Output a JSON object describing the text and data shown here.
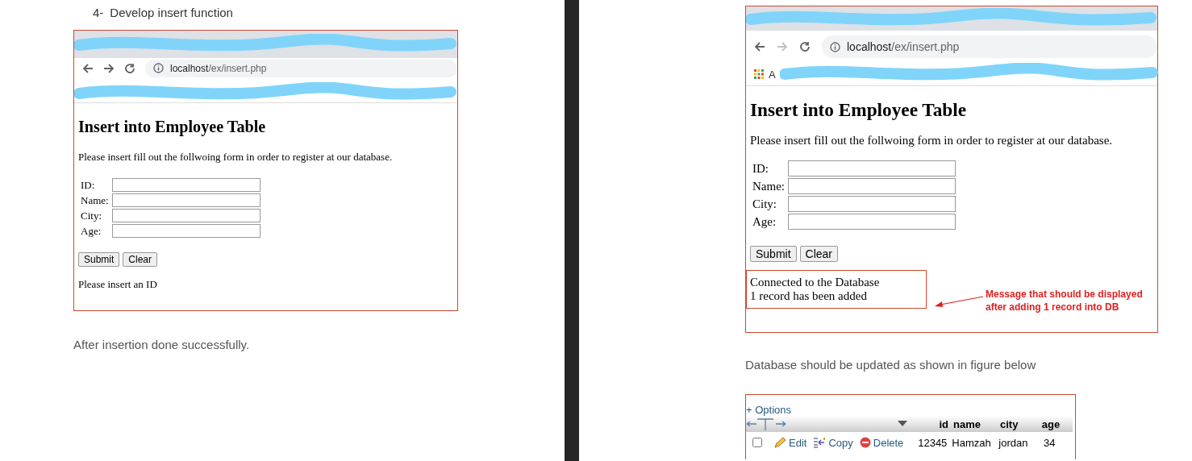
{
  "left_page": {
    "step_number": "4-",
    "step_title": "Develop insert function",
    "screenshot": {
      "address_host": "localhost",
      "address_path": "/ex/insert.php",
      "forward_enabled": true,
      "page_title": "Insert into Employee Table",
      "intro": "Please insert fill out the follwoing form in order to register at our database.",
      "fields": [
        {
          "label": "ID:"
        },
        {
          "label": "Name:"
        },
        {
          "label": "City:"
        },
        {
          "label": "Age:"
        }
      ],
      "buttons": [
        "Submit",
        "Clear"
      ],
      "messages": [
        "Please insert an ID"
      ]
    },
    "caption": "After insertion done successfully."
  },
  "right_page": {
    "screenshot": {
      "address_host": "localhost",
      "address_path": "/ex/insert.php",
      "forward_enabled": false,
      "bookmark_text": "A",
      "page_title": "Insert into Employee Table",
      "intro": "Please insert fill out the follwoing form in order to register at our database.",
      "fields": [
        {
          "label": "ID:"
        },
        {
          "label": "Name:"
        },
        {
          "label": "City:"
        },
        {
          "label": "Age:"
        }
      ],
      "buttons": [
        "Submit",
        "Clear"
      ],
      "messages": [
        "Connected to the Database",
        "1 record has been added"
      ],
      "message_boxed": true,
      "annotation": "Message that should be displayed after adding 1 record into DB"
    },
    "caption": "Database should be updated as shown in figure below",
    "db_table": {
      "options_link": "+ Options",
      "columns": [
        "id",
        "name",
        "city",
        "age"
      ],
      "rows": [
        {
          "checked": false,
          "actions": [
            {
              "kind": "edit",
              "label": "Edit"
            },
            {
              "kind": "copy",
              "label": "Copy"
            },
            {
              "kind": "delete",
              "label": "Delete"
            }
          ],
          "cells": [
            "12345",
            "Hamzah",
            "jordan",
            "34"
          ]
        }
      ]
    }
  }
}
